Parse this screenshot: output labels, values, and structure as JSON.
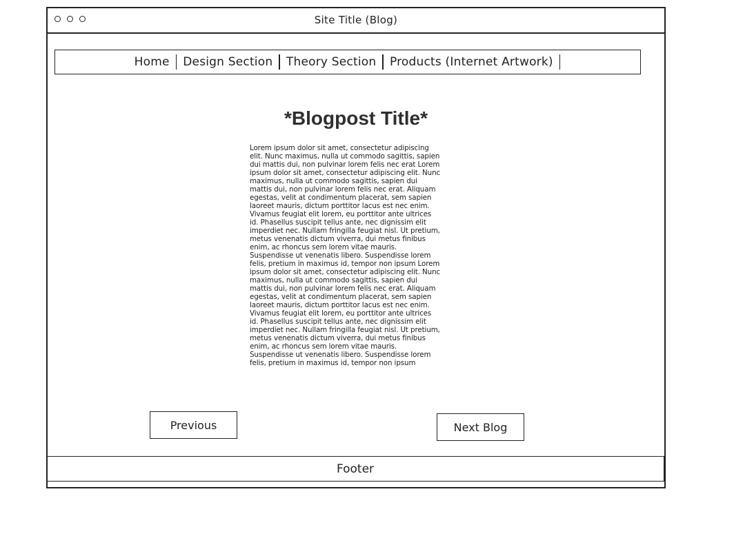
{
  "window": {
    "title": "Site Title (Blog)",
    "controls": [
      "window-dot-icon",
      "window-dot-icon",
      "window-dot-icon"
    ]
  },
  "nav": {
    "items": [
      {
        "label": "Home"
      },
      {
        "label": "Design Section"
      },
      {
        "label": "Theory Section"
      },
      {
        "label": "Products (Internet Artwork)"
      }
    ]
  },
  "post": {
    "title": "*Blogpost Title*",
    "body": "Lorem ipsum dolor sit amet, consectetur adipiscing elit. Nunc maximus, nulla ut commodo sagittis, sapien dui mattis dui, non pulvinar lorem felis nec erat Lorem ipsum dolor sit amet, consectetur adipiscing elit. Nunc maximus, nulla ut commodo sagittis, sapien dui mattis dui, non pulvinar lorem felis nec erat. Aliquam egestas, velit at condimentum placerat, sem sapien laoreet mauris, dictum porttitor lacus est nec enim. Vivamus feugiat elit lorem, eu porttitor ante ultrices id. Phasellus suscipit tellus ante, nec dignissim elit imperdiet nec. Nullam fringilla feugiat nisl. Ut pretium, metus venenatis dictum viverra, dui metus finibus enim, ac rhoncus sem lorem vitae mauris. Suspendisse ut venenatis libero. Suspendisse lorem felis, pretium in maximus id, tempor non ipsum Lorem ipsum dolor sit amet, consectetur adipiscing elit. Nunc maximus, nulla ut commodo sagittis, sapien dui mattis dui, non pulvinar lorem felis nec erat. Aliquam egestas, velit at condimentum placerat, sem sapien laoreet mauris, dictum porttitor lacus est nec enim. Vivamus feugiat elit lorem, eu porttitor ante ultrices id. Phasellus suscipit tellus ante, nec dignissim elit imperdiet nec. Nullam fringilla feugiat nisl. Ut pretium, metus venenatis dictum viverra, dui metus finibus enim, ac rhoncus sem lorem vitae mauris. Suspendisse ut venenatis libero. Suspendisse lorem felis, pretium in maximus id, tempor non ipsum"
  },
  "buttons": {
    "previous": "Previous",
    "next": "Next Blog"
  },
  "footer": {
    "label": "Footer"
  }
}
